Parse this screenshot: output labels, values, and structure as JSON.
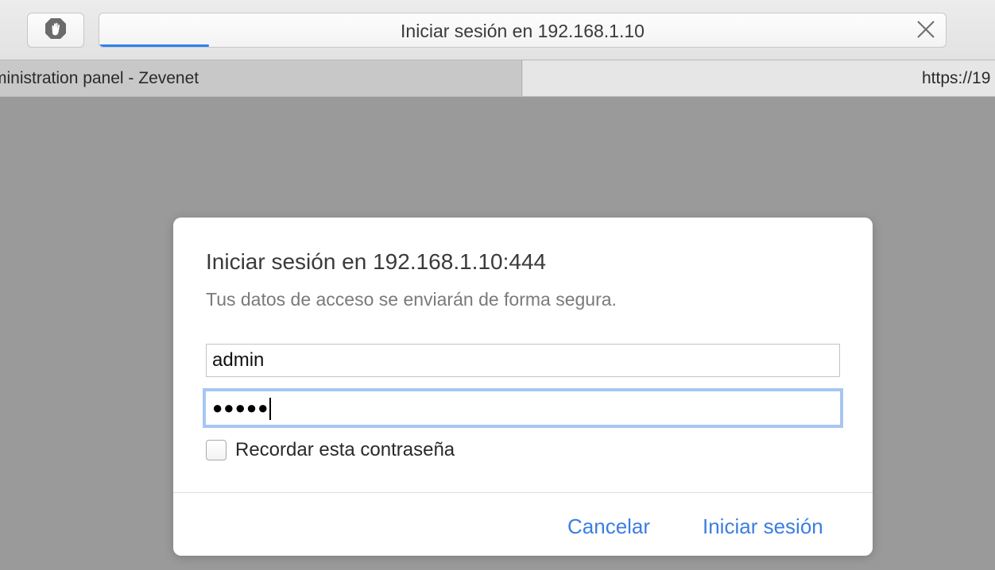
{
  "toolbar": {
    "address_title": "Iniciar sesión en 192.168.1.10",
    "load_progress": 0.13,
    "extension_icon": "hand-stop-icon",
    "close_icon": "close-icon"
  },
  "tabs": [
    {
      "label": "ministration panel - Zevenet",
      "active": true
    },
    {
      "label": "https://19",
      "active": false
    }
  ],
  "dialog": {
    "title": "Iniciar sesión en 192.168.1.10:444",
    "subtitle": "Tus datos de acceso se enviarán de forma segura.",
    "username_value": "admin",
    "password_dots": "●●●●●",
    "remember_label": "Recordar esta contraseña",
    "remember_checked": false,
    "cancel_label": "Cancelar",
    "login_label": "Iniciar sesión"
  },
  "colors": {
    "overlay_background": "#9a9a9a",
    "accent_blue": "#3b7ee0",
    "focus_ring": "#a7c6f2",
    "progress_blue": "#2d7ff0"
  }
}
